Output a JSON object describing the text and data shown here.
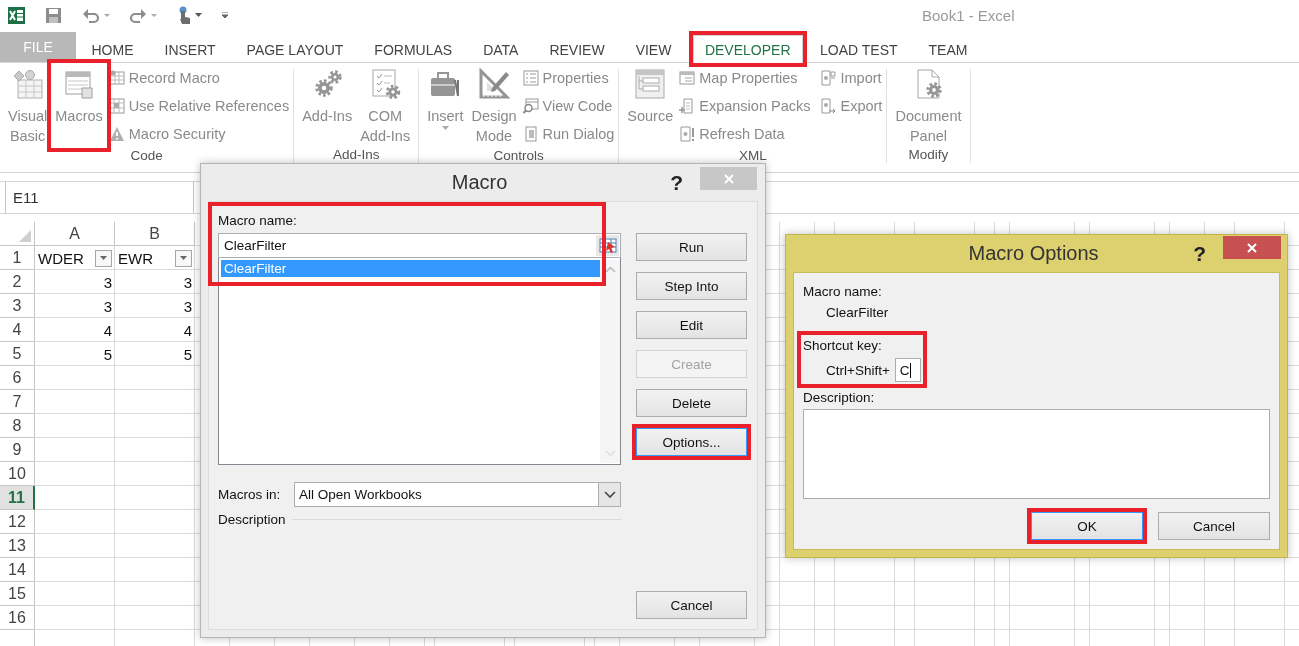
{
  "title_bar": {
    "title": "Book1 - Excel"
  },
  "tabs": [
    {
      "label": "FILE",
      "kind": "file",
      "selected": false
    },
    {
      "label": "HOME",
      "kind": "tab",
      "selected": false
    },
    {
      "label": "INSERT",
      "kind": "tab",
      "selected": false
    },
    {
      "label": "PAGE LAYOUT",
      "kind": "tab",
      "selected": false
    },
    {
      "label": "FORMULAS",
      "kind": "tab",
      "selected": false
    },
    {
      "label": "DATA",
      "kind": "tab",
      "selected": false
    },
    {
      "label": "REVIEW",
      "kind": "tab",
      "selected": false
    },
    {
      "label": "VIEW",
      "kind": "tab",
      "selected": false
    },
    {
      "label": "DEVELOPER",
      "kind": "tab",
      "selected": true,
      "highlighted": true
    },
    {
      "label": "LOAD TEST",
      "kind": "tab",
      "selected": false
    },
    {
      "label": "TEAM",
      "kind": "tab",
      "selected": false
    }
  ],
  "ribbon": {
    "groups": [
      {
        "label": "Code",
        "items": [
          {
            "kind": "large",
            "lines": [
              "Visual",
              "Basic"
            ]
          },
          {
            "kind": "large",
            "lines": [
              "Macros"
            ],
            "highlighted": true
          },
          {
            "kind": "small",
            "label": "Record Macro"
          },
          {
            "kind": "small",
            "label": "Use Relative References"
          },
          {
            "kind": "small",
            "label": "Macro Security"
          }
        ]
      },
      {
        "label": "Add-Ins",
        "items": [
          {
            "kind": "large",
            "lines": [
              "Add-Ins"
            ]
          },
          {
            "kind": "large",
            "lines": [
              "COM",
              "Add-Ins"
            ]
          }
        ]
      },
      {
        "label": "Controls",
        "items": [
          {
            "kind": "menu",
            "lines": [
              "Insert"
            ]
          },
          {
            "kind": "large",
            "lines": [
              "Design",
              "Mode"
            ]
          },
          {
            "kind": "small",
            "label": "Properties"
          },
          {
            "kind": "small",
            "label": "View Code"
          },
          {
            "kind": "small",
            "label": "Run Dialog"
          }
        ]
      },
      {
        "label": "XML",
        "items": [
          {
            "kind": "large",
            "lines": [
              "Source"
            ]
          },
          {
            "kind": "small",
            "label": "Map Properties"
          },
          {
            "kind": "small",
            "label": "Expansion Packs"
          },
          {
            "kind": "small",
            "label": "Refresh Data"
          },
          {
            "kind": "small",
            "label": "Import"
          },
          {
            "kind": "small",
            "label": "Export"
          }
        ]
      },
      {
        "label": "Modify",
        "items": [
          {
            "kind": "large",
            "lines": [
              "Document",
              "Panel"
            ]
          }
        ]
      }
    ]
  },
  "formula_bar": {
    "name_box": "E11"
  },
  "sheet": {
    "columns": [
      {
        "label": "A"
      },
      {
        "label": "B"
      }
    ],
    "rows": [
      {
        "header": "1",
        "selected": false,
        "cells": [
          {
            "text": "WDER",
            "kind": "header",
            "filter": true
          },
          {
            "text": "EWR",
            "kind": "header",
            "filter": true
          }
        ]
      },
      {
        "header": "2",
        "selected": false,
        "cells": [
          {
            "text": "3",
            "kind": "number"
          },
          {
            "text": "3",
            "kind": "number"
          }
        ]
      },
      {
        "header": "3",
        "selected": false,
        "cells": [
          {
            "text": "3",
            "kind": "number"
          },
          {
            "text": "3",
            "kind": "number"
          }
        ]
      },
      {
        "header": "4",
        "selected": false,
        "cells": [
          {
            "text": "4",
            "kind": "number"
          },
          {
            "text": "4",
            "kind": "number"
          }
        ]
      },
      {
        "header": "5",
        "selected": false,
        "cells": [
          {
            "text": "5",
            "kind": "number"
          },
          {
            "text": "5",
            "kind": "number"
          }
        ]
      },
      {
        "header": "6",
        "selected": false,
        "cells": []
      },
      {
        "header": "7",
        "selected": false,
        "cells": []
      },
      {
        "header": "8",
        "selected": false,
        "cells": []
      },
      {
        "header": "9",
        "selected": false,
        "cells": []
      },
      {
        "header": "10",
        "selected": false,
        "cells": []
      },
      {
        "header": "11",
        "selected": true,
        "cells": []
      },
      {
        "header": "12",
        "selected": false,
        "cells": []
      },
      {
        "header": "13",
        "selected": false,
        "cells": []
      },
      {
        "header": "14",
        "selected": false,
        "cells": []
      },
      {
        "header": "15",
        "selected": false,
        "cells": []
      },
      {
        "header": "16",
        "selected": false,
        "cells": []
      }
    ]
  },
  "macro_dialog": {
    "title": "Macro",
    "help": "?",
    "name_label": {
      "text": "Macro name:",
      "highlighted": true
    },
    "name_value": "ClearFilter",
    "macros": [
      {
        "name": "ClearFilter",
        "selected": true
      }
    ],
    "buttons": [
      {
        "label": "Run",
        "disabled": false,
        "focused": false
      },
      {
        "label": "Step Into",
        "disabled": false,
        "focused": false
      },
      {
        "label": "Edit",
        "disabled": false,
        "focused": false
      },
      {
        "label": "Create",
        "disabled": true,
        "focused": false
      },
      {
        "label": "Delete",
        "disabled": false,
        "focused": false
      },
      {
        "label": "Options...",
        "disabled": false,
        "focused": true,
        "highlighted": true
      }
    ],
    "macros_in_label": "Macros in:",
    "macros_in_value": "All Open Workbooks",
    "description_label": "Description",
    "cancel": "Cancel"
  },
  "options_dialog": {
    "title": "Macro Options",
    "help": "?",
    "name_label": "Macro name:",
    "name_value": "ClearFilter",
    "shortcut_label": {
      "text": "Shortcut key:",
      "highlighted": true
    },
    "shortcut_prefix": "Ctrl+Shift+",
    "shortcut_key": {
      "value": "C",
      "focused": true
    },
    "description_label": "Description:",
    "ok": {
      "label": "OK",
      "focused": true,
      "highlighted": true
    },
    "cancel": {
      "label": "Cancel",
      "focused": false
    }
  }
}
